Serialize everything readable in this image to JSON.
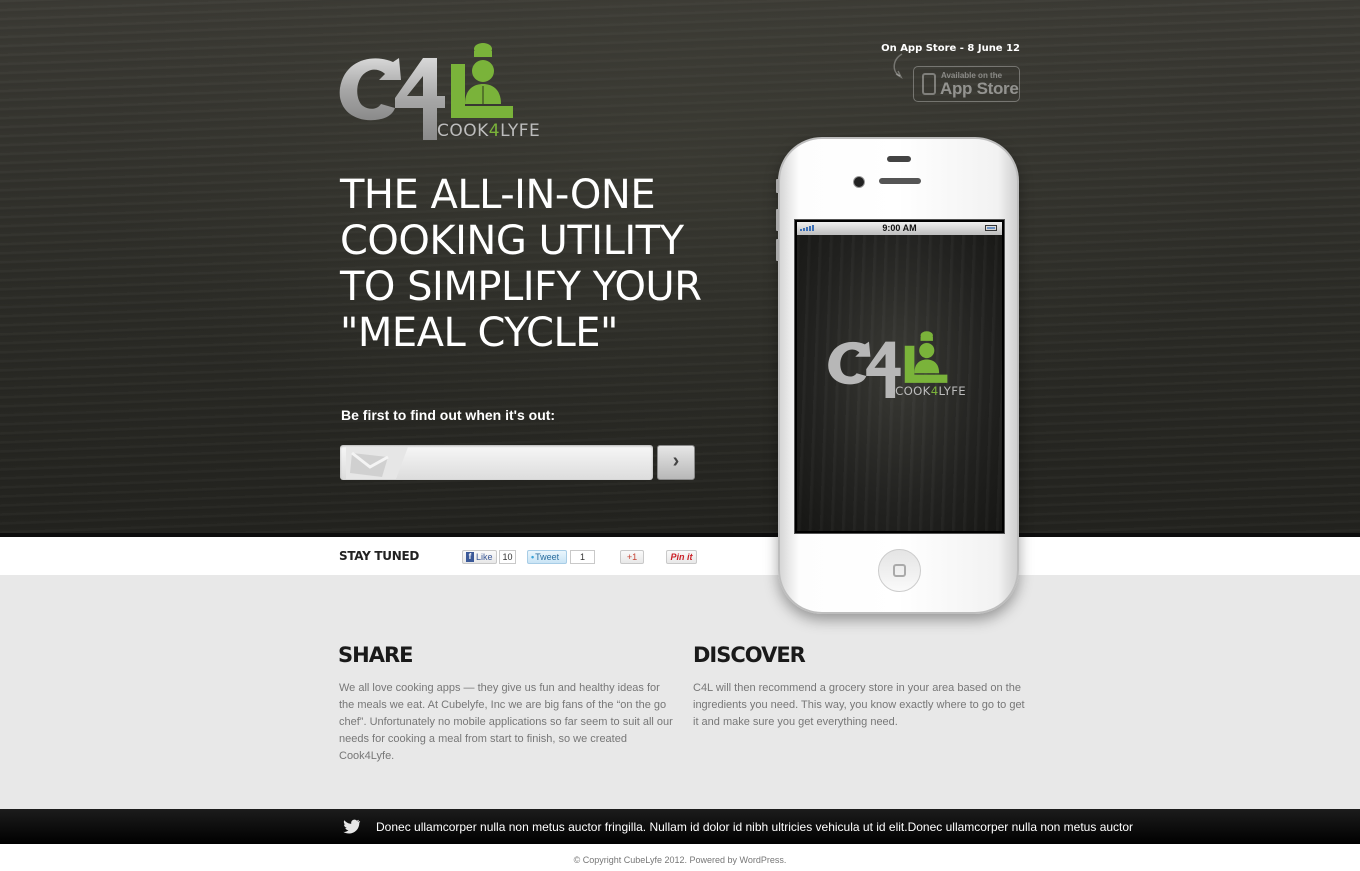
{
  "brand": {
    "logo_mark": "C4L",
    "logo_word": "COOK4LYFE",
    "colors": {
      "green": "#7ab33a",
      "silver": "#b9b9b9"
    }
  },
  "hero": {
    "headline_lines": [
      "THE ALL-IN-ONE",
      "COOKING UTILITY",
      "TO SIMPLIFY YOUR",
      "\"MEAL CYCLE\""
    ],
    "signup_label": "Be first to find out when it's out:",
    "email_placeholder": "",
    "submit_icon": "chevron-right-icon"
  },
  "appstore": {
    "date_text": "On App Store - 8 June 12",
    "badge_small": "Available on the",
    "badge_big": "App Store"
  },
  "share_bar": {
    "title": "STAY TUNED",
    "facebook_label": "Like",
    "facebook_count": "10",
    "twitter_label": "Tweet",
    "twitter_count": "1",
    "gplus_label": "+1",
    "pinterest_label": "Pin it"
  },
  "phone": {
    "status_time": "9:00 AM"
  },
  "features": {
    "share": {
      "title": "SHARE",
      "text": "We all love cooking apps — they give us fun and healthy ideas for the meals we eat. At Cubelyfe, Inc we are big fans of the “on the go chef”. Unfortunately no mobile applications so far seem to suit all our needs for cooking a meal from start to finish, so we created Cook4Lyfe."
    },
    "discover": {
      "title": "DISCOVER",
      "text": "C4L will then recommend a grocery store in your area based on the ingredients you need. This way, you know exactly where to go to get it and make sure you get everything need."
    }
  },
  "twitter": {
    "icon": "twitter-bird-icon",
    "text": "Donec ullamcorper nulla non metus auctor fringilla. Nullam id dolor id nibh ultricies vehicula ut id elit.Donec ullamcorper nulla non metus auctor"
  },
  "footer": {
    "copyright": "© Copyright CubeLyfe 2012. Powered by WordPress."
  }
}
